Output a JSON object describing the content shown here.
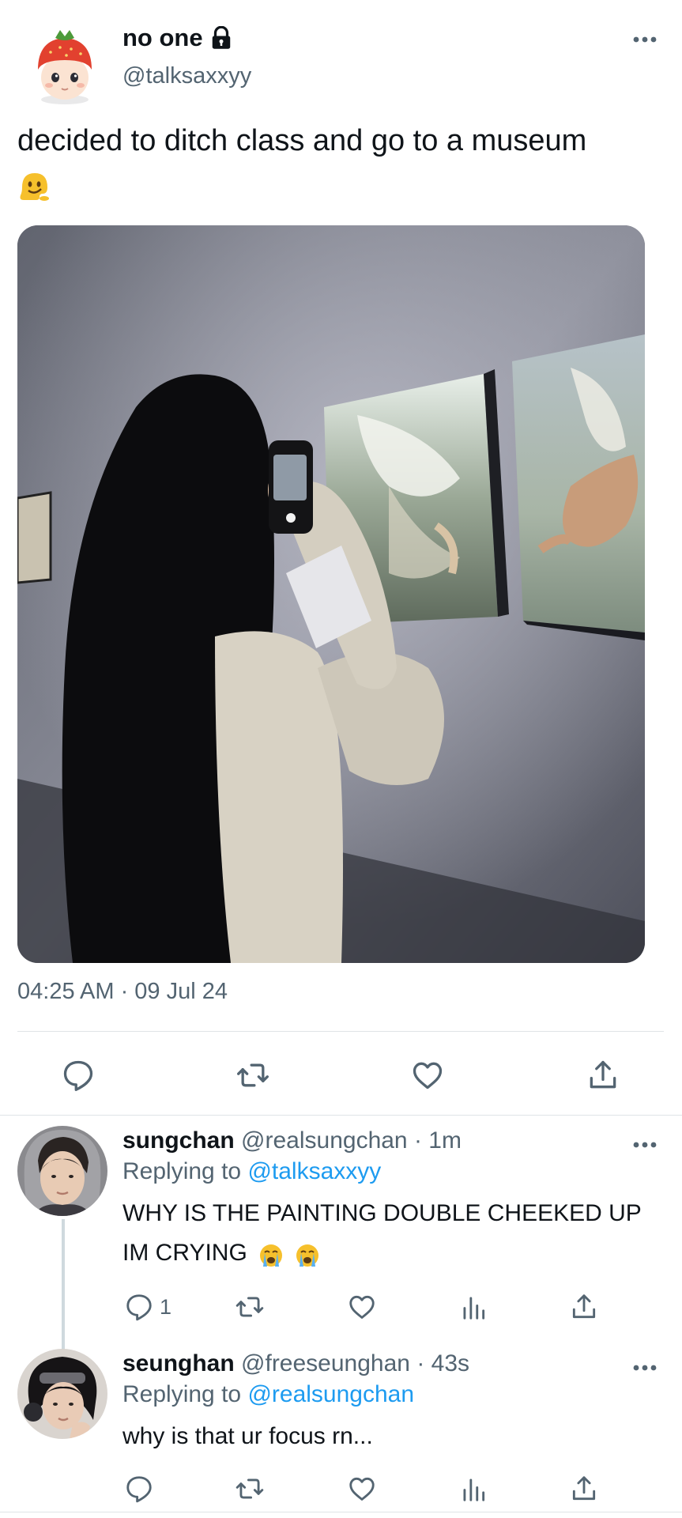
{
  "tweet": {
    "author_name": "no one",
    "author_handle": "@talksaxxyy",
    "text": "decided to ditch class and go to a museum",
    "emoji": "melting-face",
    "image_alt": "photo",
    "timestamp": "04:25 AM · 09 Jul 24",
    "actions": [
      "reply-icon",
      "retweet-icon",
      "like-icon",
      "share-icon"
    ]
  },
  "replies": [
    {
      "name": "sungchan",
      "handle": "@realsungchan",
      "time": "· 1m",
      "replying_prefix": "Replying to",
      "replying_to": "@talksaxxyy",
      "text": "WHY IS THE PAINTING DOUBLE CHEEKED UP IM CRYING",
      "emojis": [
        "loudly-crying-face",
        "loudly-crying-face"
      ],
      "reply_count": "1"
    },
    {
      "name": "seunghan",
      "handle": "@freeseunghan",
      "time": "· 43s",
      "replying_prefix": "Replying to",
      "replying_to": "@realsungchan",
      "text": "why is that ur focus rn...",
      "reply_count": ""
    }
  ],
  "colors": {
    "primary_text": "#0f1419",
    "secondary_text": "#536471",
    "accent": "#1d9bf0",
    "divider": "#dfe3e6"
  }
}
